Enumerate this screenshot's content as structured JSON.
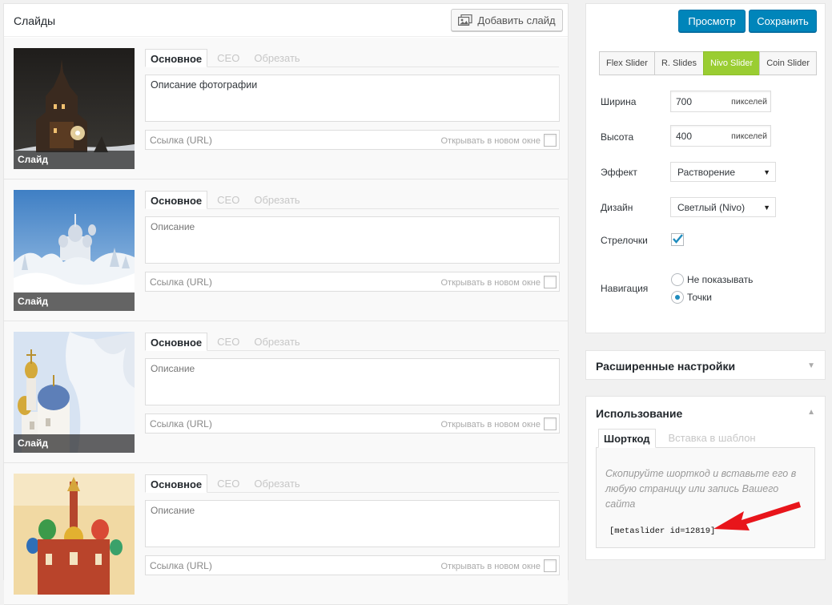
{
  "slides_panel": {
    "title": "Слайды",
    "add_button": "Добавить слайд",
    "tab_labels": [
      "Основное",
      "СЕО",
      "Обрезать"
    ],
    "url_placeholder": "Ссылка (URL)",
    "new_window_label": "Открывать в новом окне",
    "slides": [
      {
        "thumb_label": "Слайд",
        "caption": "Описание фотографии",
        "image": "night-wooden-church"
      },
      {
        "thumb_label": "Слайд",
        "caption": "Описание",
        "image": "winter-monastery"
      },
      {
        "thumb_label": "Слайд",
        "caption": "Описание",
        "image": "golden-domes-snow"
      },
      {
        "thumb_label": "",
        "caption": "Описание",
        "image": "st-basil-cathedral"
      }
    ]
  },
  "settings_panel": {
    "preview_label": "Просмотр",
    "save_label": "Сохранить",
    "slider_types": [
      {
        "label": "Flex Slider",
        "active": false
      },
      {
        "label": "R. Slides",
        "active": false
      },
      {
        "label": "Nivo Slider",
        "active": true
      },
      {
        "label": "Coin Slider",
        "active": false
      }
    ],
    "width": {
      "label": "Ширина",
      "value": "700",
      "unit": "пикселей"
    },
    "height": {
      "label": "Высота",
      "value": "400",
      "unit": "пикселей"
    },
    "effect": {
      "label": "Эффект",
      "value": "Растворение"
    },
    "theme": {
      "label": "Дизайн",
      "value": "Светлый (Nivo)"
    },
    "arrows": {
      "label": "Стрелочки",
      "checked": true
    },
    "navigation": {
      "label": "Навигация",
      "options": [
        {
          "label": "Не показывать",
          "checked": false
        },
        {
          "label": "Точки",
          "checked": true
        }
      ]
    }
  },
  "advanced": {
    "title": "Расширенные настройки"
  },
  "usage": {
    "title": "Использование",
    "tabs": [
      "Шорткод",
      "Вставка в шаблон"
    ],
    "help_text": "Скопируйте шорткод и вставьте его в любую страницу или запись Вашего сайта",
    "shortcode": "[metaslider id=12819]"
  },
  "colors": {
    "primary_button": "#0085ba",
    "active_slider_type": "#9acd32",
    "annotation_arrow": "#e8151b"
  },
  "icons": {
    "add_slide": "images-icon",
    "dropdown": "triangle-down-icon",
    "toggle_collapsed": "triangle-down-icon",
    "toggle_expanded": "triangle-up-icon"
  }
}
